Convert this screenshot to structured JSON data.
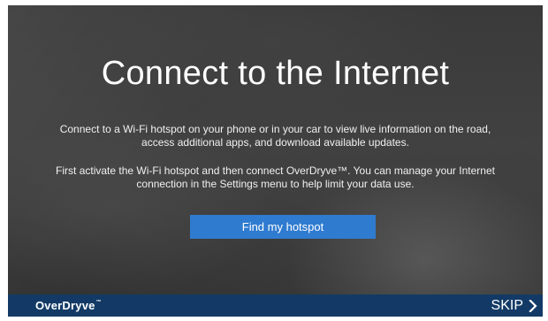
{
  "screen": {
    "title": "Connect to the Internet",
    "paragraph_1": "Connect to a Wi-Fi hotspot on your phone or in your car to view live information on the road, access additional apps, and download available updates.",
    "paragraph_2": "First activate the Wi-Fi hotspot and then connect OverDryve™. You can manage your Internet connection in the Settings menu to help limit your data use.",
    "primary_button_label": "Find my hotspot"
  },
  "footer": {
    "brand": "OverDryve",
    "brand_mark": "™",
    "skip_label": "SKIP"
  },
  "colors": {
    "button_bg": "#2f7bd0",
    "footer_bg": "#133a66",
    "background": "#3d3d3d",
    "text": "#ffffff"
  },
  "icons": {
    "skip": "chevron-right-icon"
  }
}
